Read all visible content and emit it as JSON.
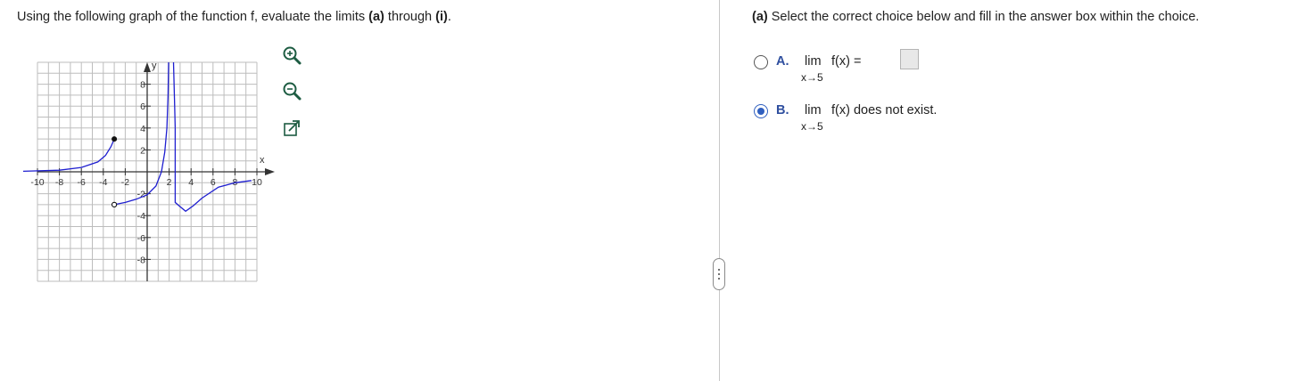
{
  "question": {
    "prefix": "Using the following graph of the function f, evaluate the limits ",
    "part_first": "(a)",
    "middle": " through ",
    "part_last": "(i)",
    "suffix": "."
  },
  "graph": {
    "y_axis_label": "y",
    "x_axis_label": "x",
    "x_ticks": [
      "-10",
      "-8",
      "-6",
      "-4",
      "-2",
      "2",
      "4",
      "6",
      "8",
      "10"
    ],
    "y_ticks": [
      "8",
      "6",
      "4",
      "2",
      "-2",
      "-4",
      "-6",
      "-8"
    ],
    "curve_color": "#1f1fd0",
    "grid_color": "#bdbdbd"
  },
  "tools": {
    "zoom_in_icon": "magnifier-plus-icon",
    "zoom_out_icon": "magnifier-minus-icon",
    "popout_icon": "new-window-icon"
  },
  "part_a": {
    "heading_bold": "(a)",
    "heading_text": " Select the correct choice below and fill in the answer box within the choice.",
    "choices": [
      {
        "letter": "A.",
        "lim": "lim",
        "expr": "f(x) =",
        "sub": "x→5",
        "answer_value": "",
        "selected": false
      },
      {
        "letter": "B.",
        "lim": "lim",
        "expr": "f(x) does not exist.",
        "sub": "x→5",
        "selected": true
      }
    ]
  },
  "accent_color": "#2f5fbf"
}
